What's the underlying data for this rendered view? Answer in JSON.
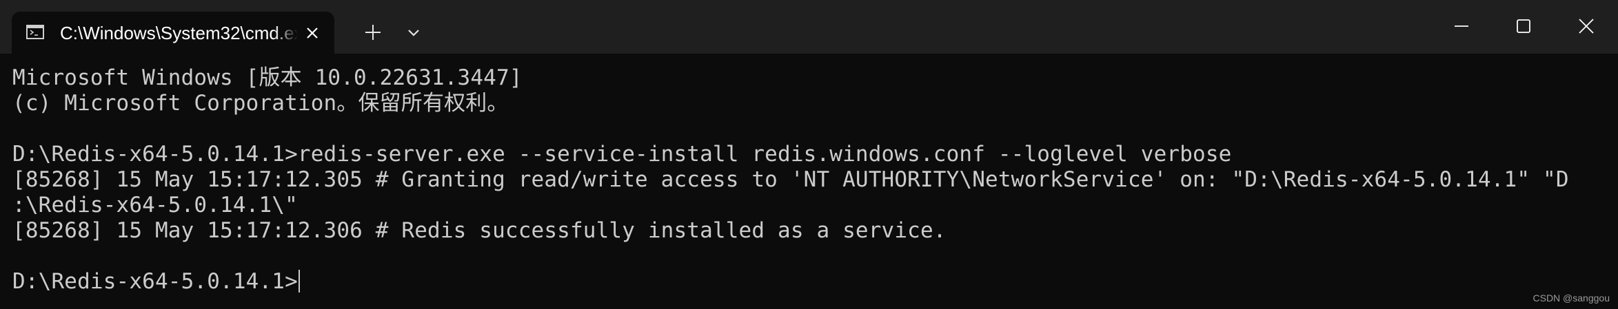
{
  "window": {
    "tab_title": "C:\\Windows\\System32\\cmd.exe",
    "tab_icon": "cmd-icon",
    "icons": {
      "close_tab": "close-icon",
      "new_tab": "plus-icon",
      "dropdown": "chevron-down-icon",
      "minimize": "minimize-icon",
      "maximize": "maximize-icon",
      "close_window": "close-icon"
    }
  },
  "terminal": {
    "lines": [
      "Microsoft Windows [版本 10.0.22631.3447]",
      "(c) Microsoft Corporation。保留所有权利。",
      "",
      "D:\\Redis-x64-5.0.14.1>redis-server.exe --service-install redis.windows.conf --loglevel verbose",
      "[85268] 15 May 15:17:12.305 # Granting read/write access to 'NT AUTHORITY\\NetworkService' on: \"D:\\Redis-x64-5.0.14.1\" \"D",
      ":\\Redis-x64-5.0.14.1\\\"",
      "[85268] 15 May 15:17:12.306 # Redis successfully installed as a service.",
      "",
      "D:\\Redis-x64-5.0.14.1>"
    ]
  },
  "watermark": "CSDN @sanggou",
  "colors": {
    "titlebar": "#1f1f1f",
    "background": "#0c0c0c",
    "text": "#cccccc"
  }
}
